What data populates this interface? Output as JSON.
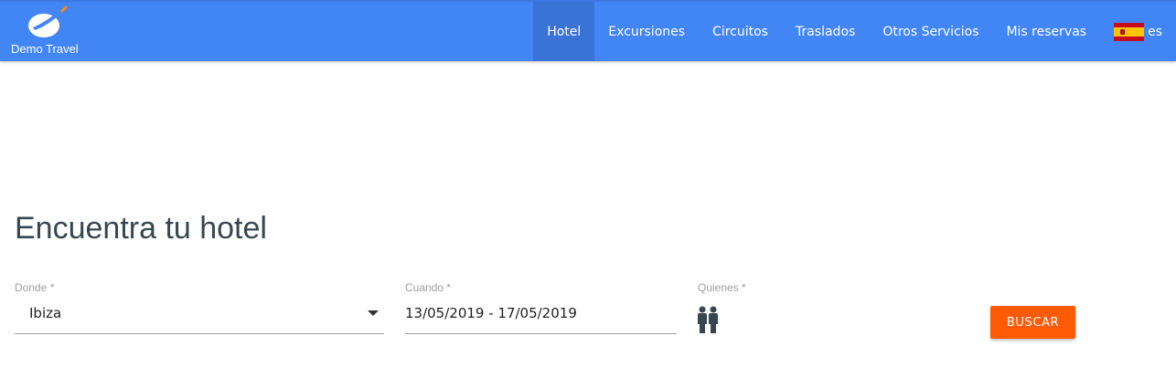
{
  "brand": {
    "name": "Demo Travel"
  },
  "nav": {
    "items": [
      {
        "label": "Hotel",
        "active": true
      },
      {
        "label": "Excursiones"
      },
      {
        "label": "Circuitos"
      },
      {
        "label": "Traslados"
      },
      {
        "label": "Otros Servicios"
      },
      {
        "label": "Mis reservas"
      }
    ],
    "language": "es"
  },
  "search": {
    "title": "Encuentra tu hotel",
    "donde": {
      "label": "Donde *",
      "value": "Ibiza"
    },
    "cuando": {
      "label": "Cuando *",
      "value": "13/05/2019 - 17/05/2019"
    },
    "quienes": {
      "label": "Quienes *",
      "icon": "people-icon"
    },
    "button_label": "BUSCAR"
  },
  "colors": {
    "header": "#4285f4",
    "button": "#ff5b06",
    "heading": "#37474f"
  }
}
